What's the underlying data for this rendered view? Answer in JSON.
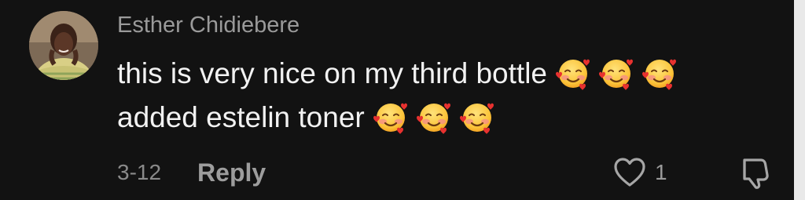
{
  "comment": {
    "author": "Esther Chidiebere",
    "text_line1": "this is very nice on my third bottle",
    "text_line2": "added estelin toner",
    "date": "3-12",
    "reply_label": "Reply",
    "like_count": "1",
    "emoji": "smiling-face-with-hearts"
  },
  "colors": {
    "background": "#121212",
    "author": "#9a9a9a",
    "text": "#f2f2f2",
    "meta": "#8a8a8a"
  }
}
